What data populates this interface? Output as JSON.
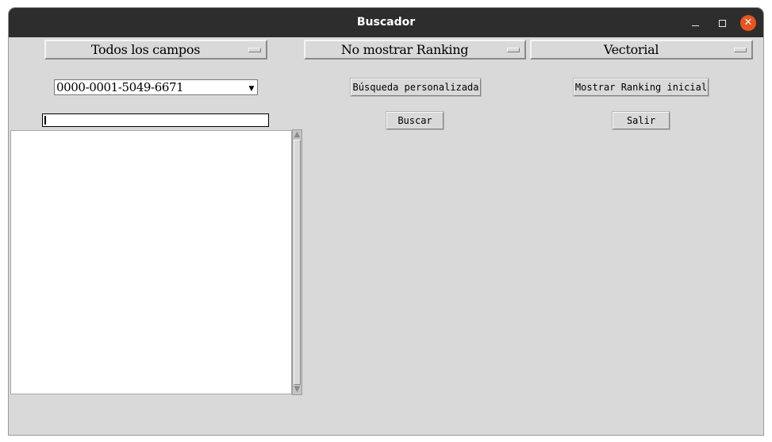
{
  "window": {
    "title": "Buscador",
    "minimize_glyph": "",
    "maximize_glyph": "",
    "close_glyph": "✕"
  },
  "options": {
    "fields": "Todos los campos",
    "ranking": "No mostrar Ranking",
    "model": "Vectorial"
  },
  "query_combo": {
    "value": "0000-0001-5049-6671",
    "arrow_glyph": "▼"
  },
  "buttons": {
    "custom_search": "Búsqueda personalizada",
    "show_ranking": "Mostrar Ranking inicial",
    "search": "Buscar",
    "exit": "Salir"
  },
  "search_entry": {
    "value": ""
  },
  "results_list": {
    "items": []
  },
  "scrollbar": {
    "up_glyph": "▲",
    "down_glyph": "▼"
  },
  "colors": {
    "window_bg": "#d9d9d9",
    "titlebar_bg": "#2d2d2d",
    "close_accent": "#e95420"
  }
}
